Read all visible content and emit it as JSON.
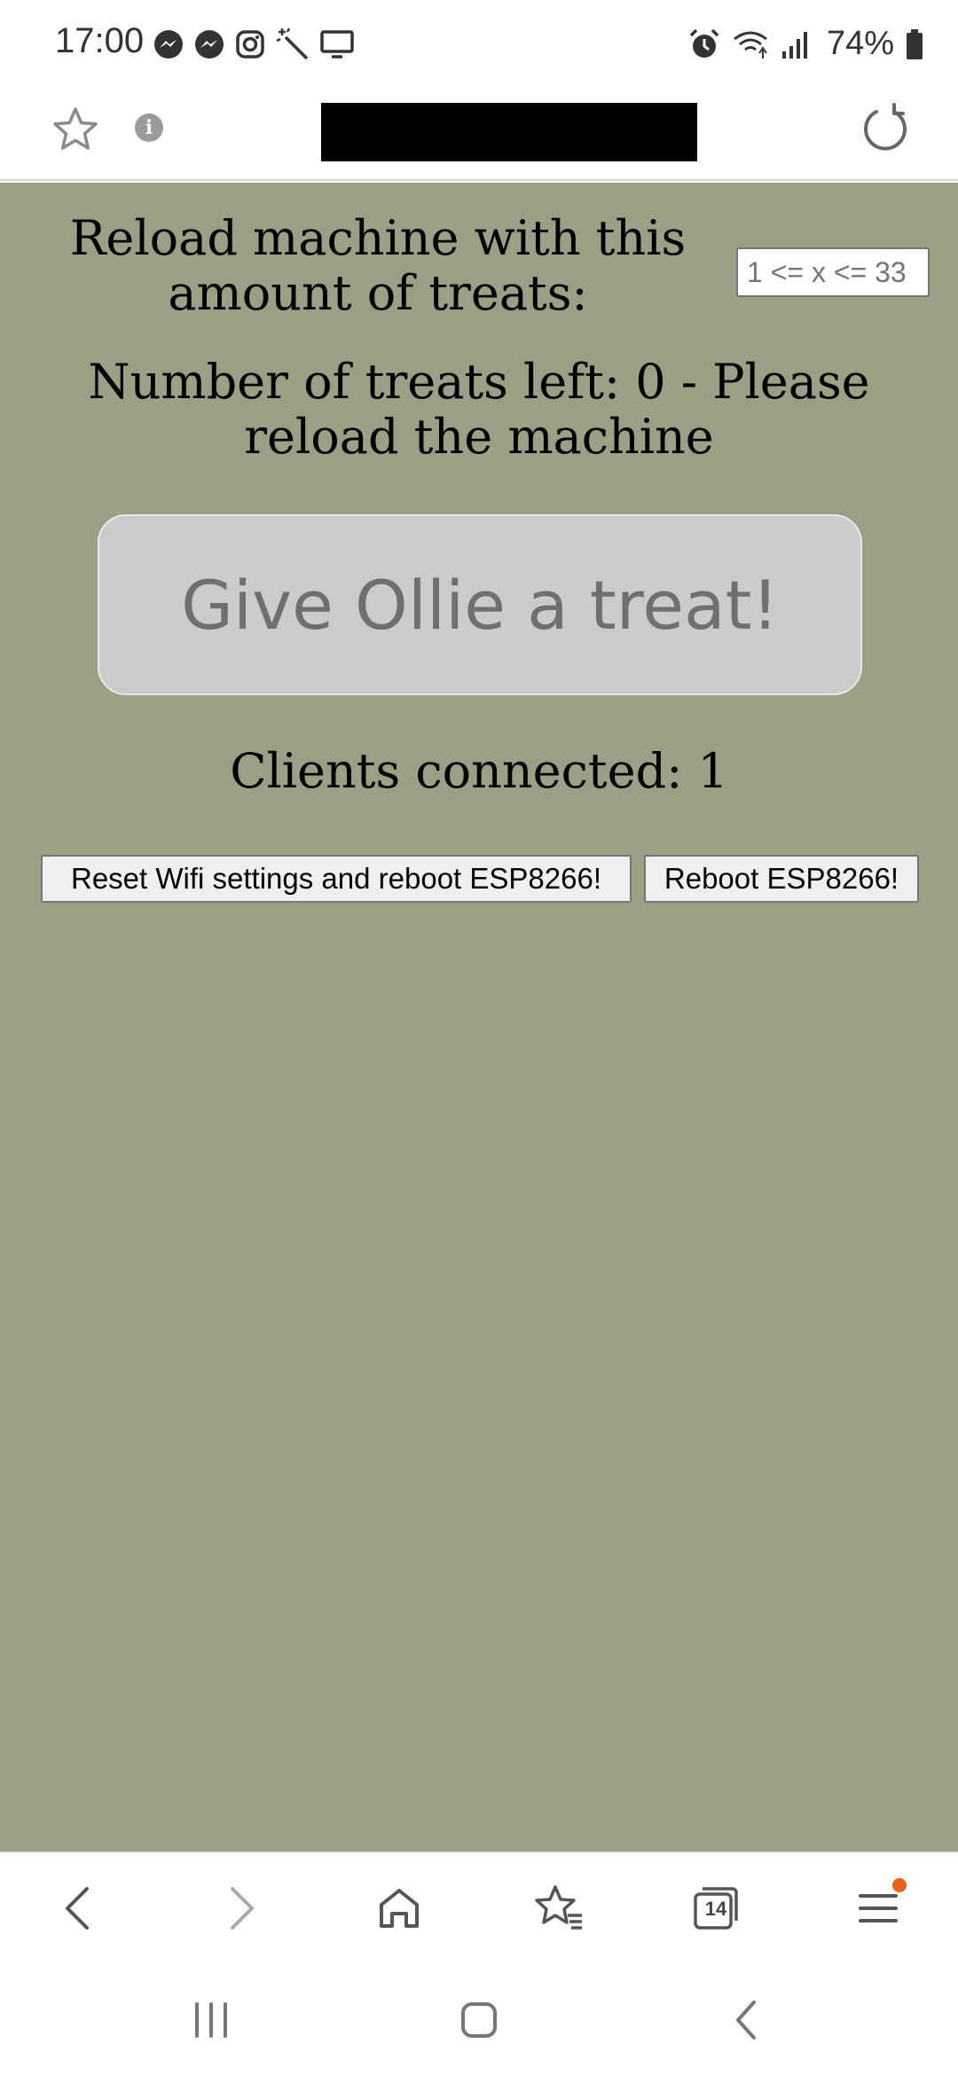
{
  "status_bar": {
    "time": "17:00",
    "battery": "74%",
    "left_icons": [
      "messenger-icon",
      "messenger-icon",
      "instagram-icon",
      "magic-wand-icon",
      "screen-icon"
    ],
    "right_icons": [
      "alarm-icon",
      "wifi-icon",
      "signal-icon",
      "battery-icon"
    ]
  },
  "browser": {
    "url_redacted": true,
    "icons": [
      "star-icon",
      "info-icon",
      "reload-icon"
    ]
  },
  "page": {
    "background_color": "#9c9f84",
    "reload_label": "Reload machine with this amount of treats:",
    "reload_placeholder": "1 <= x <= 33",
    "treats_left": "Number of treats left: 0 - Please reload the machine",
    "treat_button_label": "Give Ollie a treat!",
    "clients_connected": "Clients connected: 1",
    "reset_button_label": "Reset Wifi settings and reboot ESP8266!",
    "reboot_button_label": "Reboot ESP8266!"
  },
  "bottom_bar": {
    "tab_count": "14",
    "icons": [
      "back-icon",
      "forward-icon",
      "home-icon",
      "bookmarks-icon",
      "tabs-icon",
      "menu-icon"
    ],
    "accent_color": "#e8601c"
  },
  "system_nav": {
    "icons": [
      "recents-icon",
      "home-icon",
      "back-icon"
    ]
  }
}
